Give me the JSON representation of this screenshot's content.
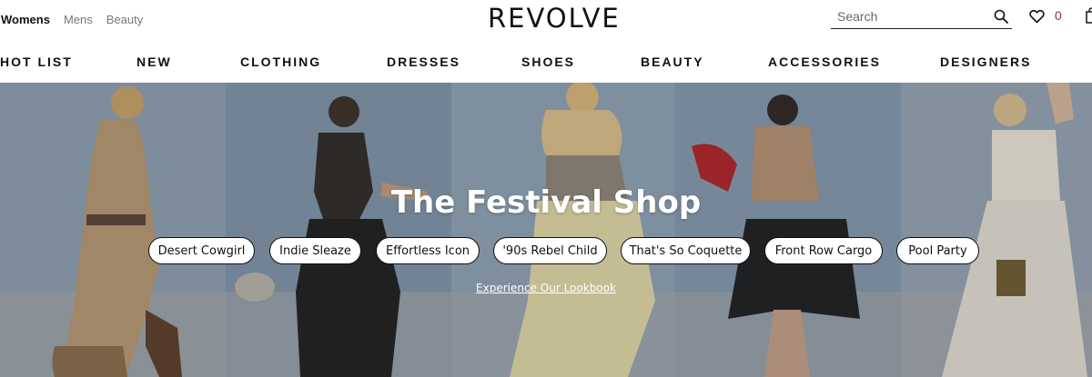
{
  "header": {
    "gender_tabs": [
      {
        "label": "Womens",
        "active": true
      },
      {
        "label": "Mens",
        "active": false
      },
      {
        "label": "Beauty",
        "active": false
      }
    ],
    "logo": "REVOLVE",
    "search_placeholder": "Search",
    "wishlist_count": "0",
    "accent_color": "#8b2a6d"
  },
  "nav": {
    "items": [
      "HOT LIST",
      "NEW",
      "CLOTHING",
      "DRESSES",
      "SHOES",
      "BEAUTY",
      "ACCESSORIES",
      "DESIGNERS"
    ]
  },
  "hero": {
    "title": "The Festival Shop",
    "pills": [
      "Desert Cowgirl",
      "Indie Sleaze",
      "Effortless Icon",
      "'90s Rebel Child",
      "That's So Coquette",
      "Front Row Cargo",
      "Pool Party"
    ],
    "link": "Experience Our Lookbook"
  }
}
